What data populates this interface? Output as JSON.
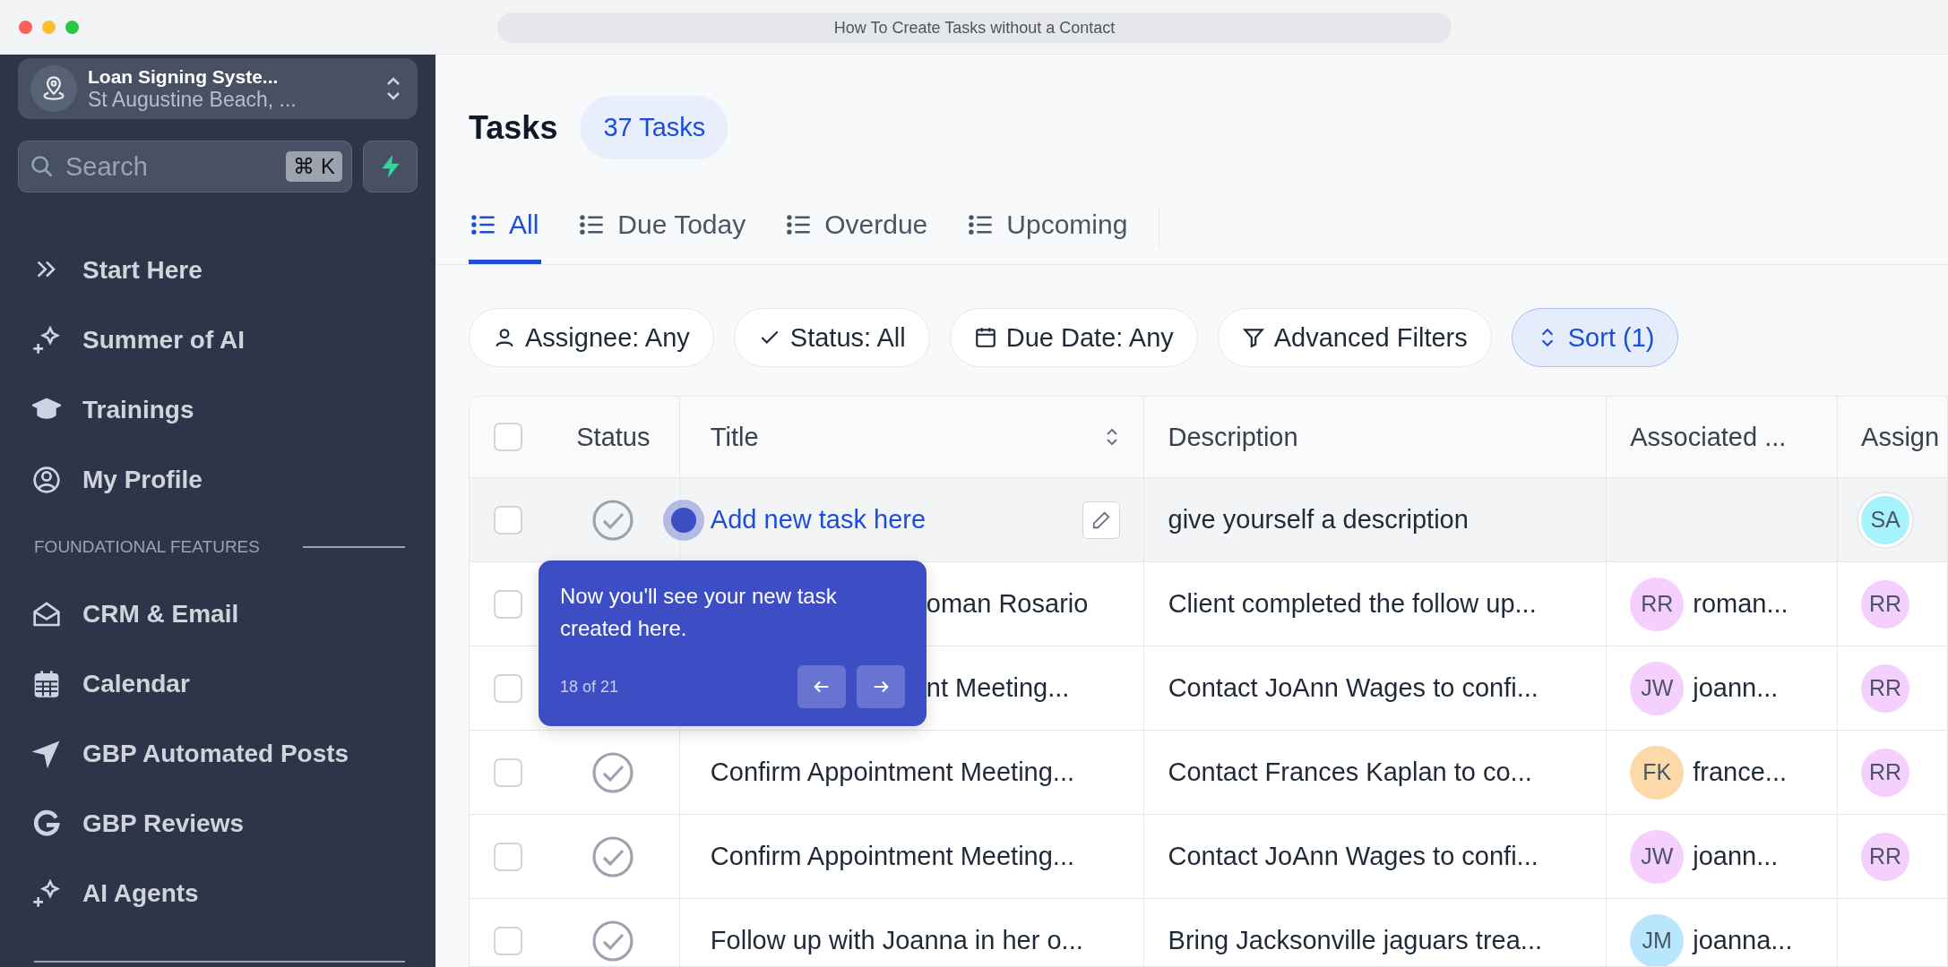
{
  "window": {
    "title": "How To Create Tasks without a Contact"
  },
  "sidebar": {
    "location": {
      "name": "Loan Signing Syste...",
      "address": "St Augustine Beach, ..."
    },
    "search": {
      "placeholder": "Search",
      "shortcut": "⌘ K"
    },
    "items": [
      {
        "label": "Start Here"
      },
      {
        "label": "Summer of AI"
      },
      {
        "label": "Trainings"
      },
      {
        "label": "My Profile"
      }
    ],
    "section": "FOUNDATIONAL FEATURES",
    "section_items": [
      {
        "label": "CRM & Email"
      },
      {
        "label": "Calendar"
      },
      {
        "label": "GBP Automated Posts"
      },
      {
        "label": "GBP Reviews"
      },
      {
        "label": "AI Agents"
      }
    ]
  },
  "header": {
    "title": "Tasks",
    "count": "37 Tasks"
  },
  "tabs": [
    {
      "label": "All",
      "selected": true
    },
    {
      "label": "Due Today",
      "selected": false
    },
    {
      "label": "Overdue",
      "selected": false
    },
    {
      "label": "Upcoming",
      "selected": false
    }
  ],
  "filters": [
    {
      "label": "Assignee: Any",
      "selected": false
    },
    {
      "label": "Status: All",
      "selected": false
    },
    {
      "label": "Due Date: Any",
      "selected": false
    },
    {
      "label": "Advanced Filters",
      "selected": false
    },
    {
      "label": "Sort (1)",
      "selected": true
    }
  ],
  "table": {
    "select_all": {
      "checked": false
    },
    "columns": [
      "Status",
      "Title",
      "Description",
      "Associated ...",
      "Assign"
    ],
    "rows": [
      {
        "kind": "new",
        "checked": false,
        "title": "Add new task here",
        "description": "give yourself a description",
        "assignee": {
          "initials": "SA",
          "color": "#a5f3fc"
        }
      },
      {
        "kind": "covered",
        "checked": false,
        "title": "oman Rosario",
        "description": "Client completed the follow up...",
        "associated": {
          "initials": "RR",
          "name": "roman...",
          "color": "#f5d0fe"
        },
        "assignee": {
          "initials": "RR",
          "color": "#f5d0fe"
        }
      },
      {
        "kind": "covered",
        "checked": false,
        "title": "nt Meeting...",
        "description": "Contact JoAnn Wages to confi...",
        "associated": {
          "initials": "JW",
          "name": "joann...",
          "color": "#f5d0fe"
        },
        "assignee": {
          "initials": "RR",
          "color": "#f5d0fe"
        }
      },
      {
        "kind": "task",
        "checked": false,
        "title": "Confirm Appointment Meeting...",
        "description": "Contact Frances Kaplan to co...",
        "associated": {
          "initials": "FK",
          "name": "france...",
          "color": "#fcd9a8"
        },
        "assignee": {
          "initials": "RR",
          "color": "#f5d0fe"
        }
      },
      {
        "kind": "task",
        "checked": false,
        "title": "Confirm Appointment Meeting...",
        "description": "Contact JoAnn Wages to confi...",
        "associated": {
          "initials": "JW",
          "name": "joann...",
          "color": "#f5d0fe"
        },
        "assignee": {
          "initials": "RR",
          "color": "#f5d0fe"
        }
      },
      {
        "kind": "task",
        "checked": false,
        "title": "Follow up with Joanna in her o...",
        "description": "Bring Jacksonville jaguars trea...",
        "associated": {
          "initials": "JM",
          "name": "joanna...",
          "color": "#bae6fd"
        }
      }
    ]
  },
  "tour": {
    "text": "Now you'll see your new task created here.",
    "progress": "18 of 21"
  }
}
